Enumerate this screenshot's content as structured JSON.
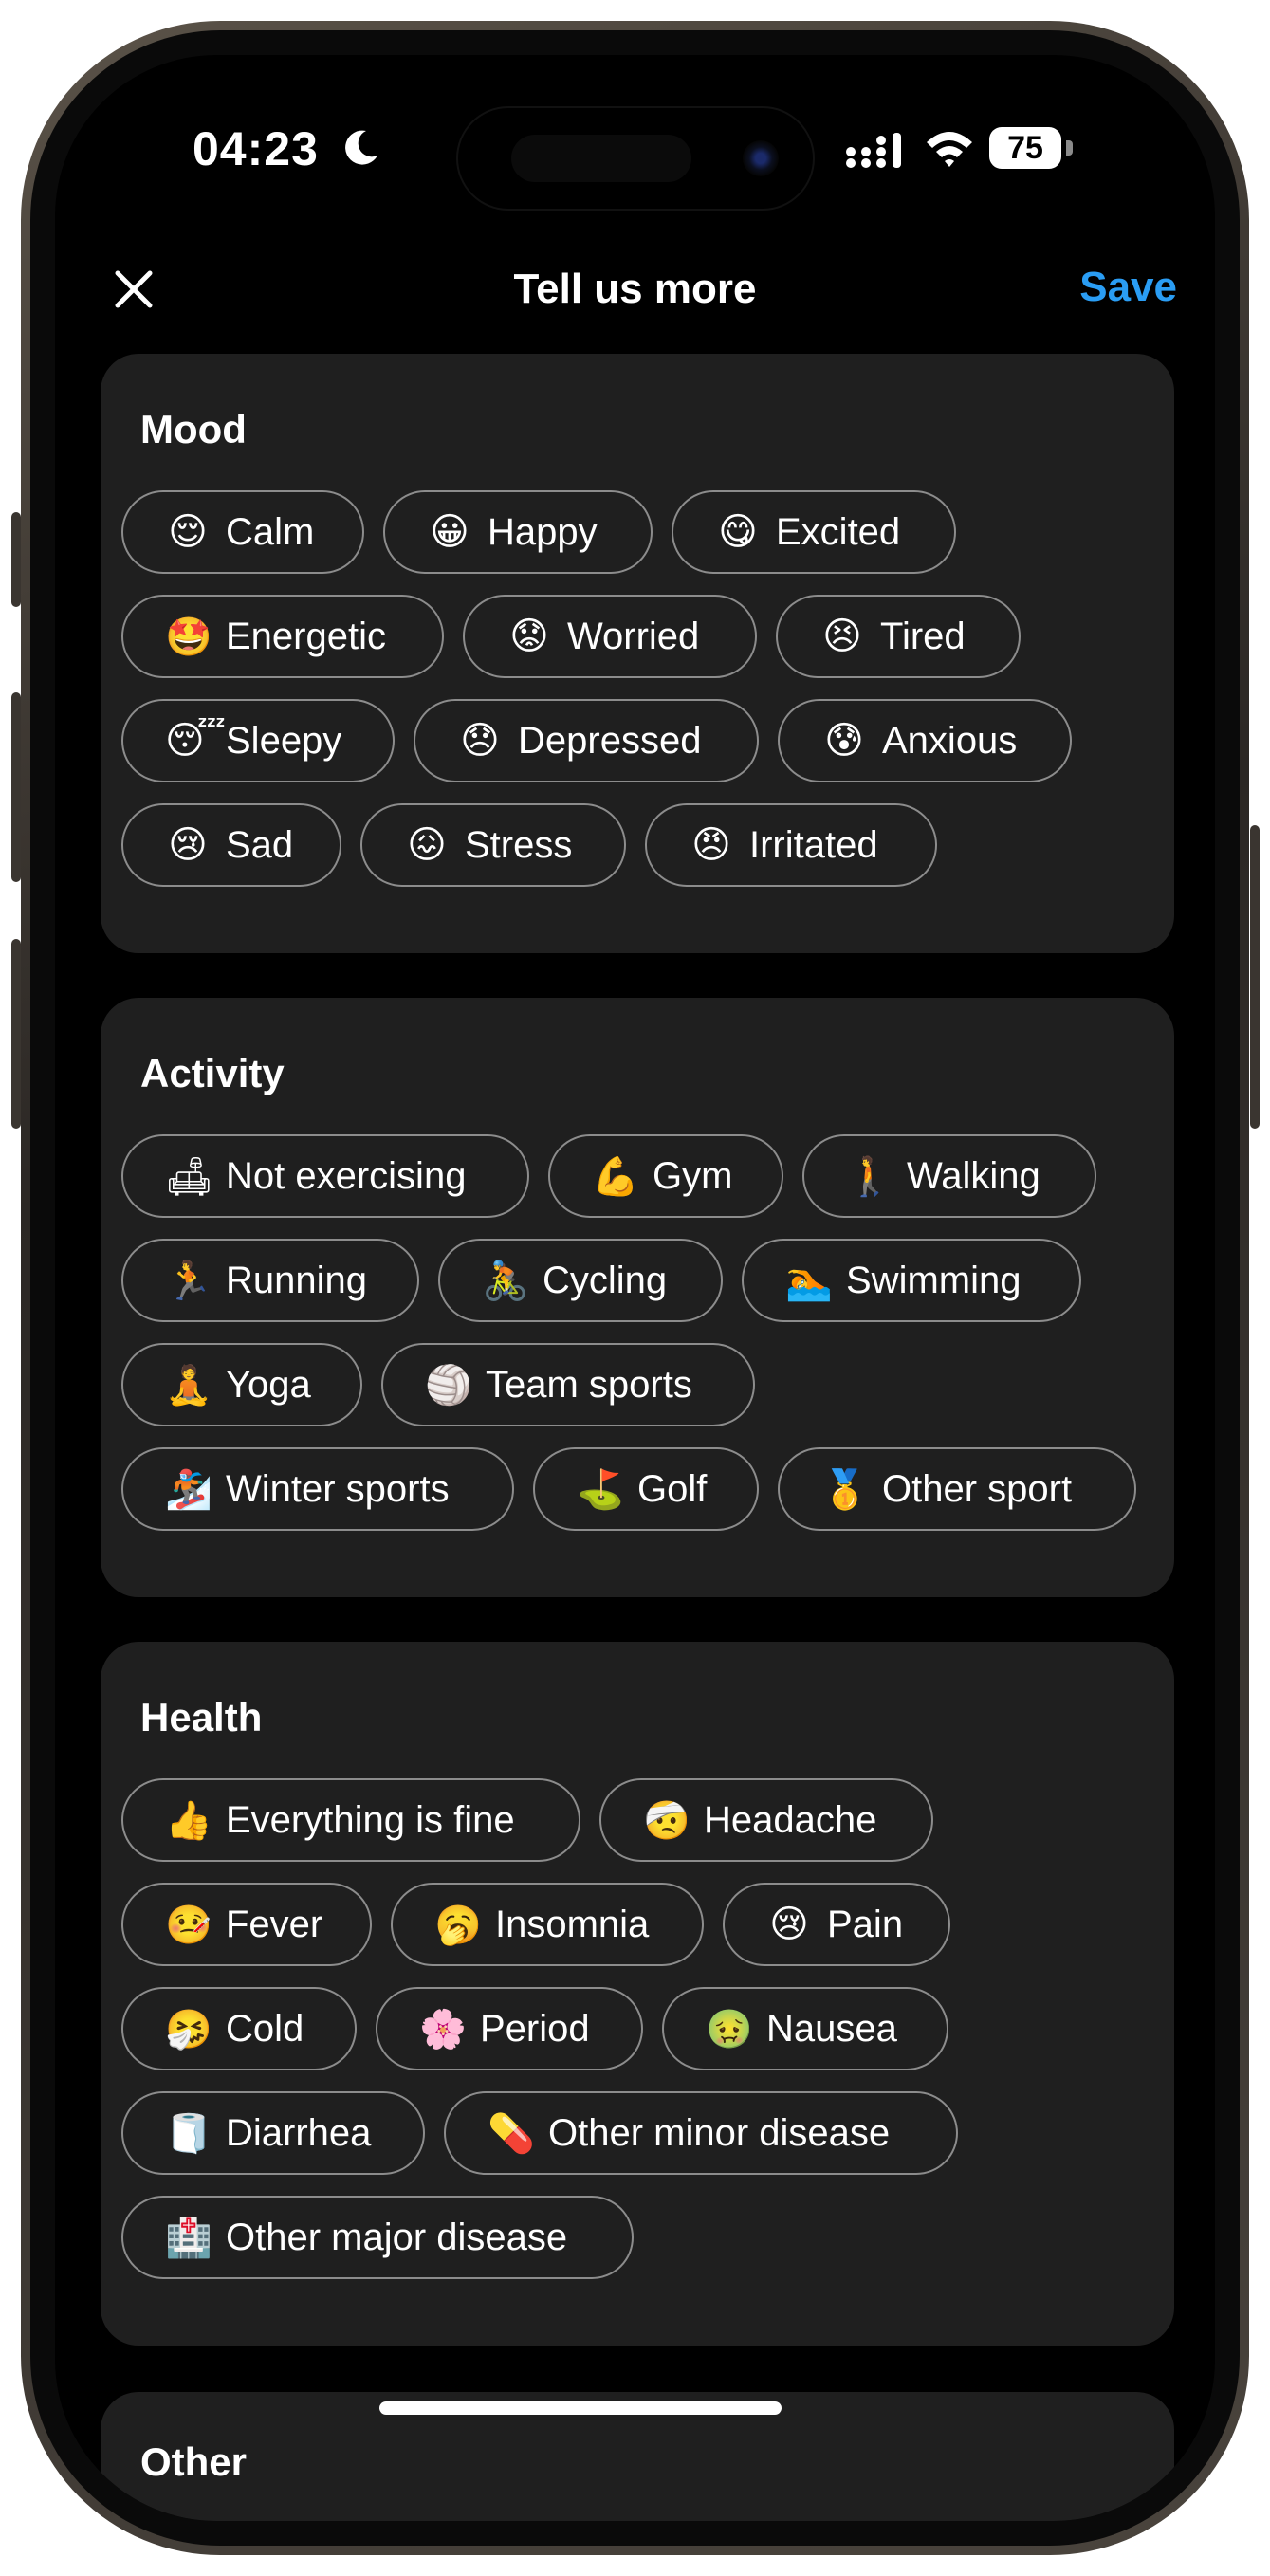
{
  "status_bar": {
    "time": "04:23",
    "battery": "75"
  },
  "nav": {
    "title": "Tell us more",
    "save_label": "Save"
  },
  "sections": {
    "mood": {
      "title": "Mood",
      "chips": [
        {
          "emoji": "😌",
          "label": "Calm"
        },
        {
          "emoji": "😀",
          "label": "Happy"
        },
        {
          "emoji": "😋",
          "label": "Excited"
        },
        {
          "emoji": "🤩",
          "label": "Energetic"
        },
        {
          "emoji": "😟",
          "label": "Worried"
        },
        {
          "emoji": "😣",
          "label": "Tired"
        },
        {
          "emoji": "😴",
          "label": "Sleepy"
        },
        {
          "emoji": "😞",
          "label": "Depressed"
        },
        {
          "emoji": "😰",
          "label": "Anxious"
        },
        {
          "emoji": "😢",
          "label": "Sad"
        },
        {
          "emoji": "😖",
          "label": "Stress"
        },
        {
          "emoji": "😠",
          "label": "Irritated"
        }
      ]
    },
    "activity": {
      "title": "Activity",
      "chips": [
        {
          "emoji": "🛋",
          "label": "Not exercising"
        },
        {
          "emoji": "💪",
          "label": "Gym"
        },
        {
          "emoji": "🚶",
          "label": "Walking"
        },
        {
          "emoji": "🏃",
          "label": "Running"
        },
        {
          "emoji": "🚴",
          "label": "Cycling"
        },
        {
          "emoji": "🏊",
          "label": "Swimming"
        },
        {
          "emoji": "🧘",
          "label": "Yoga"
        },
        {
          "emoji": "🏐",
          "label": "Team sports"
        },
        {
          "emoji": "🏂",
          "label": "Winter sports"
        },
        {
          "emoji": "⛳",
          "label": "Golf"
        },
        {
          "emoji": "🥇",
          "label": "Other sport"
        }
      ]
    },
    "health": {
      "title": "Health",
      "chips": [
        {
          "emoji": "👍",
          "label": "Everything is fine"
        },
        {
          "emoji": "🤕",
          "label": "Headache"
        },
        {
          "emoji": "🤒",
          "label": "Fever"
        },
        {
          "emoji": "🥱",
          "label": "Insomnia"
        },
        {
          "emoji": "😢",
          "label": "Pain"
        },
        {
          "emoji": "🤧",
          "label": "Cold"
        },
        {
          "emoji": "🌸",
          "label": "Period"
        },
        {
          "emoji": "🤢",
          "label": "Nausea"
        },
        {
          "emoji": "🧻",
          "label": "Diarrhea"
        },
        {
          "emoji": "💊",
          "label": "Other minor disease"
        },
        {
          "emoji": "🏥",
          "label": "Other major disease"
        }
      ]
    },
    "other": {
      "title": "Other"
    }
  },
  "colors": {
    "accent": "#2a9df4",
    "card_bg": "#1f1f1f",
    "chip_border": "#8c8c8c",
    "screen_bg": "#000000"
  }
}
